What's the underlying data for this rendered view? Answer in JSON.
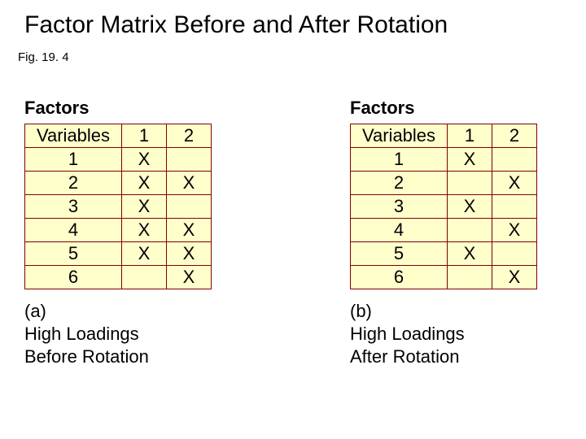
{
  "title": "Factor Matrix Before and After Rotation",
  "fig": "Fig. 19. 4",
  "factors_label": "Factors",
  "headers": {
    "var": "Variables",
    "f1": "1",
    "f2": "2"
  },
  "panel_a": {
    "tag": "(a)",
    "caption_l1": "High Loadings",
    "caption_l2": "Before Rotation",
    "rows": [
      {
        "v": "1",
        "f1": "X",
        "f2": ""
      },
      {
        "v": "2",
        "f1": "X",
        "f2": "X"
      },
      {
        "v": "3",
        "f1": "X",
        "f2": ""
      },
      {
        "v": "4",
        "f1": "X",
        "f2": "X"
      },
      {
        "v": "5",
        "f1": "X",
        "f2": "X"
      },
      {
        "v": "6",
        "f1": "",
        "f2": "X"
      }
    ]
  },
  "panel_b": {
    "tag": "(b)",
    "caption_l1": "High Loadings",
    "caption_l2": "After Rotation",
    "rows": [
      {
        "v": "1",
        "f1": "X",
        "f2": ""
      },
      {
        "v": "2",
        "f1": "",
        "f2": "X"
      },
      {
        "v": "3",
        "f1": "X",
        "f2": ""
      },
      {
        "v": "4",
        "f1": "",
        "f2": "X"
      },
      {
        "v": "5",
        "f1": "X",
        "f2": ""
      },
      {
        "v": "6",
        "f1": "",
        "f2": "X"
      }
    ]
  },
  "chart_data": [
    {
      "type": "table",
      "title": "(a) High Loadings Before Rotation",
      "columns": [
        "Variables",
        "1",
        "2"
      ],
      "rows": [
        [
          "1",
          "X",
          ""
        ],
        [
          "2",
          "X",
          "X"
        ],
        [
          "3",
          "X",
          ""
        ],
        [
          "4",
          "X",
          "X"
        ],
        [
          "5",
          "X",
          "X"
        ],
        [
          "6",
          "",
          "X"
        ]
      ]
    },
    {
      "type": "table",
      "title": "(b) High Loadings After Rotation",
      "columns": [
        "Variables",
        "1",
        "2"
      ],
      "rows": [
        [
          "1",
          "X",
          ""
        ],
        [
          "2",
          "",
          "X"
        ],
        [
          "3",
          "X",
          ""
        ],
        [
          "4",
          "",
          "X"
        ],
        [
          "5",
          "X",
          ""
        ],
        [
          "6",
          "",
          "X"
        ]
      ]
    }
  ]
}
